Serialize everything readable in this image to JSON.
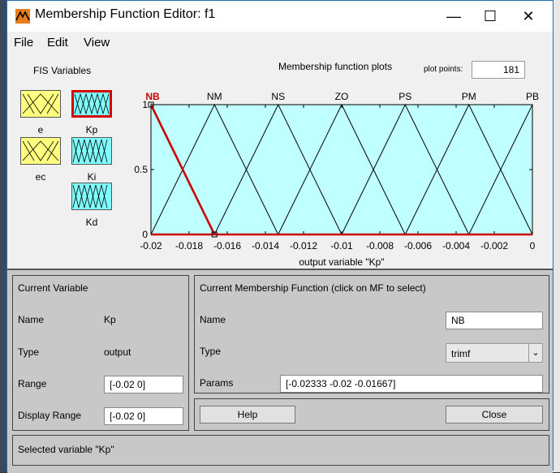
{
  "window": {
    "title": "Membership Function Editor: f1"
  },
  "titlebar": {
    "minimize": "—",
    "maximize": "☐",
    "close": "✕"
  },
  "menu": [
    "File",
    "Edit",
    "View"
  ],
  "fis": {
    "title": "FIS Variables",
    "vars": [
      {
        "label": "e",
        "color": "#ffff80"
      },
      {
        "label": "Kp",
        "color": "#80ffff",
        "selected": true
      },
      {
        "label": "ec",
        "color": "#ffff80"
      },
      {
        "label": "Ki",
        "color": "#80ffff"
      },
      {
        "label": "Kd",
        "color": "#80ffff"
      }
    ]
  },
  "plot": {
    "title": "Membership function plots",
    "points_label": "plot points:",
    "points_value": "181",
    "xlabel": "output variable \"Kp\""
  },
  "chart_data": {
    "type": "line",
    "xlim": [
      -0.02,
      0
    ],
    "ylim": [
      0,
      1
    ],
    "xticks": [
      "-0.02",
      "-0.018",
      "-0.016",
      "-0.014",
      "-0.012",
      "-0.01",
      "-0.008",
      "-0.006",
      "-0.004",
      "-0.002",
      "0"
    ],
    "yticks": [
      "0",
      "0.5",
      "1"
    ],
    "xlabel": "output variable \"Kp\"",
    "background": "#c0ffff",
    "series": [
      {
        "name": "NB",
        "params": [
          -0.02333,
          -0.02,
          -0.01667
        ],
        "color": "#cc0000",
        "highlight": true
      },
      {
        "name": "NM",
        "params": [
          -0.02,
          -0.01667,
          -0.01333
        ],
        "color": "#000000"
      },
      {
        "name": "NS",
        "params": [
          -0.01667,
          -0.01333,
          -0.01
        ],
        "color": "#000000"
      },
      {
        "name": "ZO",
        "params": [
          -0.01333,
          -0.01,
          -0.00667
        ],
        "color": "#000000"
      },
      {
        "name": "PS",
        "params": [
          -0.01,
          -0.00667,
          -0.00333
        ],
        "color": "#000000"
      },
      {
        "name": "PM",
        "params": [
          -0.00667,
          -0.00333,
          0
        ],
        "color": "#000000"
      },
      {
        "name": "PB",
        "params": [
          -0.00333,
          0,
          0.00333
        ],
        "color": "#000000"
      }
    ]
  },
  "current_variable": {
    "title": "Current Variable",
    "name_label": "Name",
    "name_value": "Kp",
    "type_label": "Type",
    "type_value": "output",
    "range_label": "Range",
    "range_value": "[-0.02 0]",
    "display_range_label": "Display Range",
    "display_range_value": "[-0.02 0]"
  },
  "current_mf": {
    "title": "Current Membership Function (click on MF to select)",
    "name_label": "Name",
    "name_value": "NB",
    "type_label": "Type",
    "type_value": "trimf",
    "params_label": "Params",
    "params_value": "[-0.02333 -0.02 -0.01667]"
  },
  "buttons": {
    "help": "Help",
    "close": "Close"
  },
  "status": "Selected variable \"Kp\""
}
